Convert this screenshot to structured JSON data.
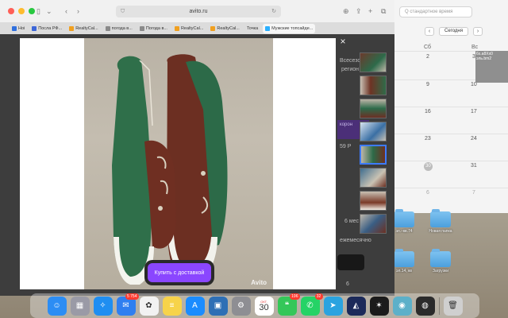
{
  "browser": {
    "url": "avito.ru",
    "tabs": [
      {
        "label": "Ноі",
        "favicon_color": "#2f6fde",
        "active": false
      },
      {
        "label": "Посла РФ...",
        "favicon_color": "#3c66d8",
        "active": false
      },
      {
        "label": "RealtyCal...",
        "favicon_color": "#f0a020",
        "active": false
      },
      {
        "label": "погода в...",
        "favicon_color": "#8a8a8a",
        "active": false
      },
      {
        "label": "Погода в...",
        "favicon_color": "#8a8a8a",
        "active": false
      },
      {
        "label": "RealtyCal...",
        "favicon_color": "#f0a020",
        "active": false
      },
      {
        "label": "RealtyCal...",
        "favicon_color": "#f0a020",
        "active": false
      },
      {
        "label": "Точка",
        "favicon_color": "#f0a020",
        "active": false
      },
      {
        "label": "Мужские топсайде...",
        "favicon_color": "#2bb0ff",
        "active": true
      }
    ]
  },
  "page_bg": {
    "snippet_1": "Всесезон",
    "snippet_2": "регион",
    "snippet_3": "корон",
    "snippet_4": "59 Р",
    "snippet_5": "6 мес",
    "snippet_6": "ежемесячно",
    "snippet_7": "6"
  },
  "lightbox": {
    "buy_label": "Купить с доставкой",
    "watermark": "Avito",
    "close_symbol": "×",
    "thumb_count": 8,
    "active_thumb": 5
  },
  "calendar": {
    "search_placeholder": "Q  стандартное время",
    "today_label": "Сегодня",
    "prev": "‹",
    "next": "›",
    "col_headers": [
      "Сб",
      "Вс"
    ],
    "rows": [
      {
        "sat": "2",
        "sun": "3"
      },
      {
        "sat": "9",
        "sun": "10"
      },
      {
        "sat": "16",
        "sun": "17"
      },
      {
        "sat": "23",
        "sun": "24"
      },
      {
        "sat": "30",
        "sun": "31"
      },
      {
        "sat": "6",
        "sun": "7"
      }
    ],
    "event_text": "6x.a8Xx0 эль.bm2"
  },
  "desktop": {
    "folders": [
      {
        "label": "эл.–кв.74"
      },
      {
        "label": "Новая папка"
      },
      {
        "label": "эл.14, кв"
      },
      {
        "label": "Загрузки"
      }
    ]
  },
  "dock": {
    "apps": [
      {
        "name": "finder-app",
        "glyph": "☺",
        "color": "#2c8df4",
        "badge": ""
      },
      {
        "name": "launchpad-app",
        "glyph": "▦",
        "color": "#9a9aa6",
        "badge": ""
      },
      {
        "name": "safari-app",
        "glyph": "✧",
        "color": "#1f8ef1",
        "badge": ""
      },
      {
        "name": "mail-app",
        "glyph": "✉",
        "color": "#2f7ff0",
        "badge": "5 754"
      },
      {
        "name": "photos-app",
        "glyph": "✿",
        "color": "#f2f2f2",
        "badge": ""
      },
      {
        "name": "notes-app",
        "glyph": "≡",
        "color": "#f7d34a",
        "badge": ""
      },
      {
        "name": "appstore-app",
        "glyph": "A",
        "color": "#1a8cff",
        "badge": ""
      },
      {
        "name": "remote-app",
        "glyph": "▣",
        "color": "#2e6fb5",
        "badge": ""
      },
      {
        "name": "settings-app",
        "glyph": "⚙",
        "color": "#8e8e93",
        "badge": ""
      },
      {
        "name": "calendar-app",
        "glyph": "30",
        "color": "#ffffff",
        "badge": ""
      },
      {
        "name": "messages-app",
        "glyph": "❝",
        "color": "#35c759",
        "badge": "196"
      },
      {
        "name": "whatsapp-app",
        "glyph": "✆",
        "color": "#25d366",
        "badge": "32"
      },
      {
        "name": "telegram-app",
        "glyph": "➤",
        "color": "#2aa3e0",
        "badge": ""
      },
      {
        "name": "app-14",
        "glyph": "◭",
        "color": "#1c2a5a",
        "badge": ""
      },
      {
        "name": "app-15",
        "glyph": "✶",
        "color": "#1b1b1b",
        "badge": ""
      },
      {
        "name": "app-16",
        "glyph": "◉",
        "color": "#5cb0c9",
        "badge": ""
      },
      {
        "name": "app-17",
        "glyph": "◍",
        "color": "#2b2b2b",
        "badge": ""
      },
      {
        "name": "trash-app",
        "glyph": "🗑",
        "color": "#cfcfcf",
        "badge": ""
      }
    ],
    "calendar_month": "ОКТ.",
    "calendar_day": "30"
  }
}
